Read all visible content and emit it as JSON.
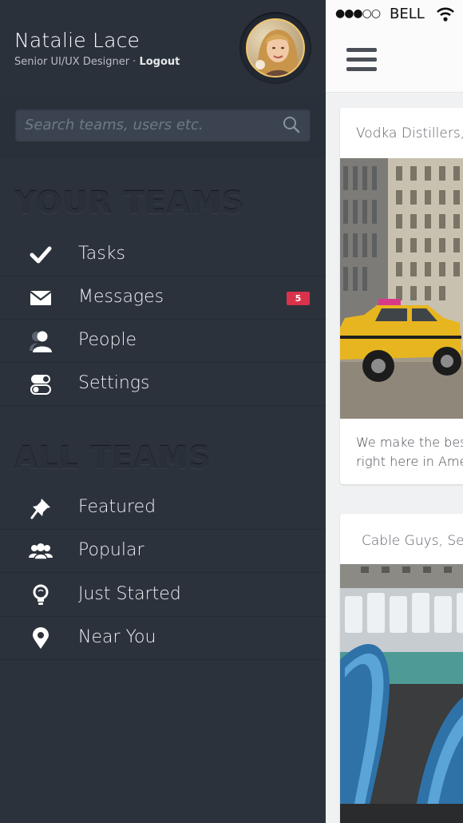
{
  "profile": {
    "name": "Natalie Lace",
    "role": "Senior UI/UX Designer · ",
    "logout": "Logout"
  },
  "search": {
    "placeholder": "Search teams, users etc.",
    "icon": "search-icon"
  },
  "sections": {
    "your_teams": "YOUR TEAMS",
    "all_teams": "ALL TEAMS"
  },
  "your_teams": [
    {
      "label": "Tasks",
      "icon": "checkmark-icon"
    },
    {
      "label": "Messages",
      "icon": "envelope-icon",
      "badge": "5"
    },
    {
      "label": "People",
      "icon": "person-icon"
    },
    {
      "label": "Settings",
      "icon": "toggle-icon"
    }
  ],
  "all_teams": [
    {
      "label": "Featured",
      "icon": "pin-icon"
    },
    {
      "label": "Popular",
      "icon": "group-icon"
    },
    {
      "label": "Just Started",
      "icon": "lightbulb-icon"
    },
    {
      "label": "Near You",
      "icon": "map-marker-icon"
    }
  ],
  "status_bar": {
    "signal": "●●●○○",
    "carrier": "BELL"
  },
  "cards": [
    {
      "title": "Vodka Distillers, S",
      "text_line1": "We make the best",
      "text_line2": "right here in Ameri"
    },
    {
      "title": "Cable Guys, Sea"
    }
  ],
  "colors": {
    "sidebar_bg": "#2c323c",
    "badge": "#d8334a",
    "content_bg": "#f0f1f2"
  }
}
